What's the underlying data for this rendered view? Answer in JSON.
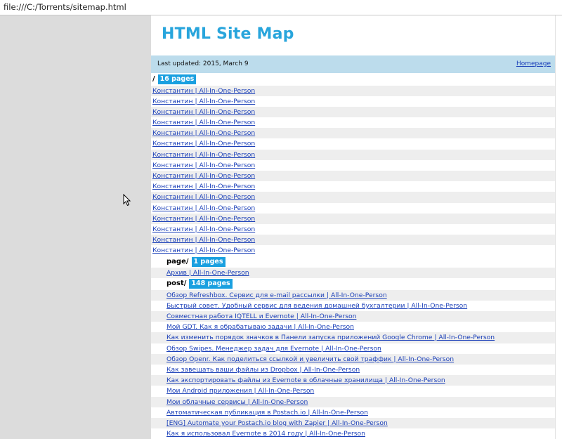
{
  "browser": {
    "address": "file:///C:/Torrents/sitemap.html"
  },
  "sitemap": {
    "title": "HTML Site Map",
    "last_updated": "Last updated: 2015, March 9",
    "homepage_label": "Homepage",
    "sections": [
      {
        "path": "/",
        "count": "16 pages",
        "level": 0,
        "items": [
          "Константин | All-In-One-Person",
          "Константин | All-In-One-Person",
          "Константин | All-In-One-Person",
          "Константин | All-In-One-Person",
          "Константин | All-In-One-Person",
          "Константин | All-In-One-Person",
          "Константин | All-In-One-Person",
          "Константин | All-In-One-Person",
          "Константин | All-In-One-Person",
          "Константин | All-In-One-Person",
          "Константин | All-In-One-Person",
          "Константин | All-In-One-Person",
          "Константин | All-In-One-Person",
          "Константин | All-In-One-Person",
          "Константин | All-In-One-Person",
          "Константин | All-In-One-Person"
        ]
      },
      {
        "path": "page/",
        "count": "1 pages",
        "level": 1,
        "items": [
          "Архив | All-In-One-Person"
        ]
      },
      {
        "path": "post/",
        "count": "148 pages",
        "level": 1,
        "items": [
          "Обзор Refreshbox. Сервис для e-mail рассылки | All-In-One-Person",
          "Быстрый совет. Удобный сервис для ведения домашней бухгалтерии | All-In-One-Person",
          "Совместная работа IQTELL и Evernote | All-In-One-Person",
          "Мой GDT. Как я обрабатываю задачи | All-In-One-Person",
          "Как изменить порядок значков в Панели запуска приложений Google Chrome | All-In-One-Person",
          "Обзор Swipes. Менеджер задач для Evernote | All-In-One-Person",
          "Обзор Openr. Как поделиться ссылкой и увеличить свой траффик | All-In-One-Person",
          "Как завещать ваши файлы из Dropbox | All-In-One-Person",
          "Как экспортировать файлы из Evernote в облачные хранилища | All-In-One-Person",
          "Мои Android приложения | All-In-One-Person",
          "Мои облачные сервисы | All-In-One-Person",
          "Автоматическая публикация в Postach.io | All-In-One-Person",
          "[ENG] Automate your Postach.io blog with Zapier | All-In-One-Person",
          "Как я использовал Evernote в 2014 году | All-In-One-Person"
        ]
      }
    ]
  },
  "colors": {
    "title": "#28a5dc",
    "badge": "#1aa0e0",
    "updated_bar": "#bcdcec",
    "link": "#1a3fb8",
    "alt_row": "#eeeeee"
  }
}
